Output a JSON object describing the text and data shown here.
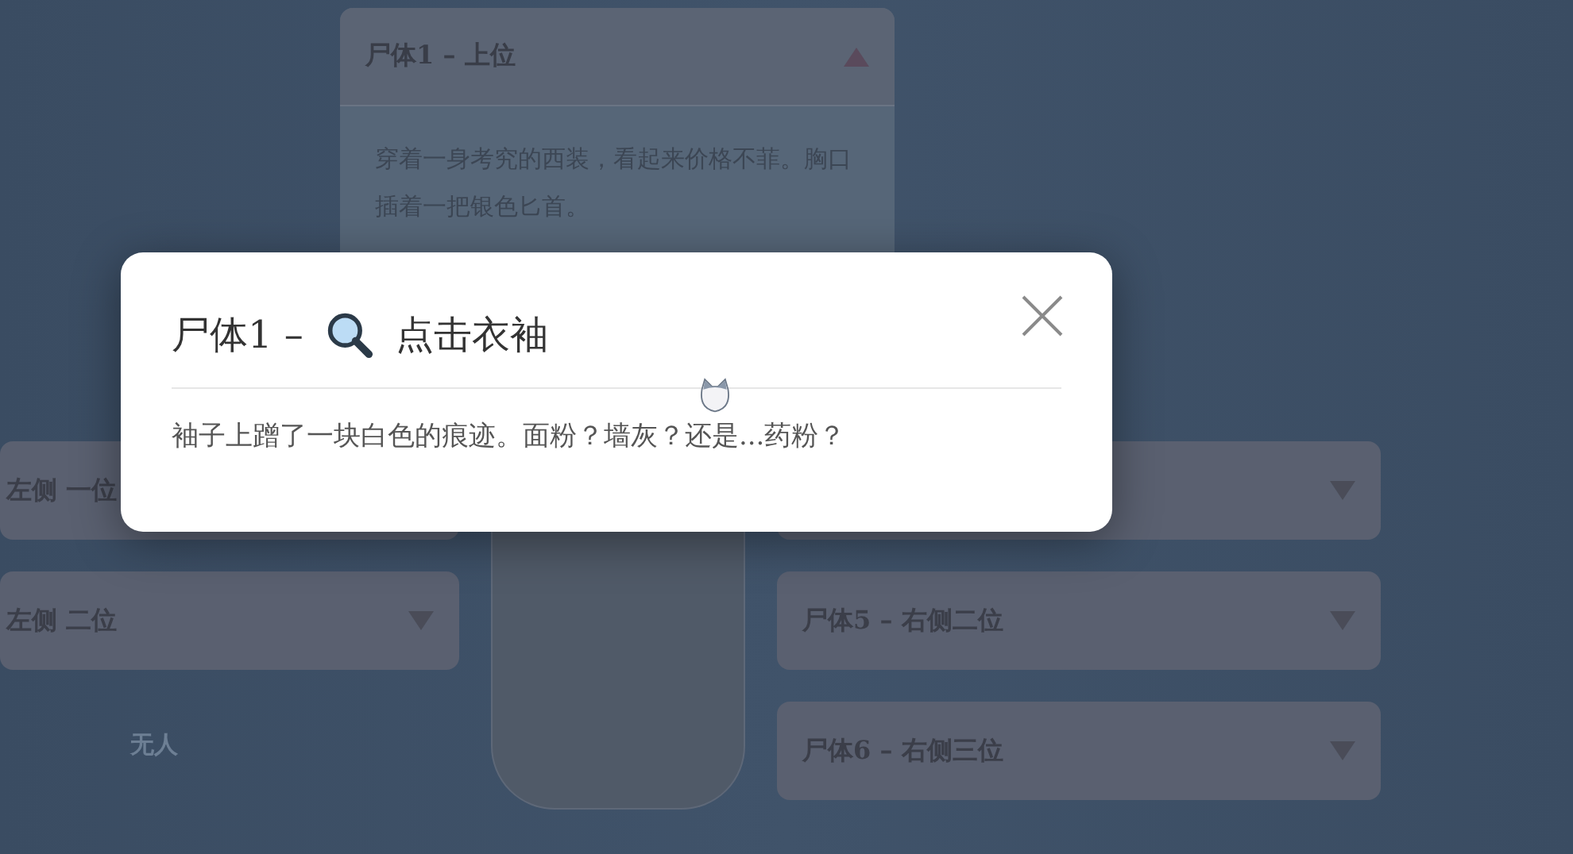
{
  "top_card": {
    "title": "尸体1 – 上位",
    "expanded": true,
    "description": "穿着一身考究的西装，看起来价格不菲。胸口插着一把银色匕首。"
  },
  "left_slots": [
    {
      "title": "左侧 一位"
    },
    {
      "title": "左侧 二位",
      "expanded": false
    }
  ],
  "left_empty": "无人",
  "right_slots": [
    {
      "expanded": false
    },
    {
      "title": "尸体5 – 右侧二位",
      "expanded": false
    },
    {
      "title": "尸体6 – 右侧三位",
      "expanded": false
    }
  ],
  "dialog": {
    "title": "尸体1 –",
    "action": "点击衣袖",
    "body": "袖子上蹭了一块白色的痕迹。面粉？墙灰？还是...药粉？"
  }
}
